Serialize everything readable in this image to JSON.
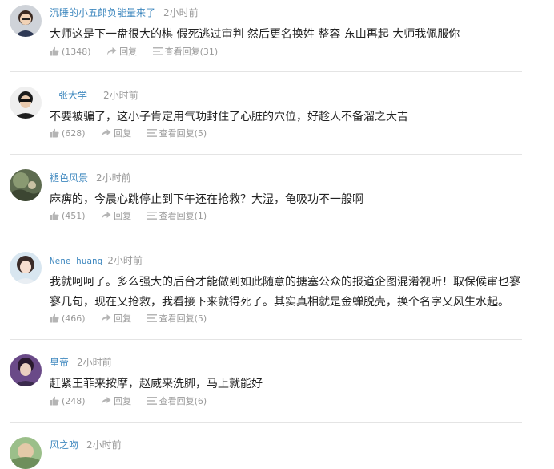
{
  "comments": [
    {
      "user": "沉睡的小五郎负能量来了",
      "time": "2小时前",
      "text": "大师这是下一盘很大的棋  假死逃过审判  然后更名换姓  整容  东山再起  大师我佩服你",
      "likes": "(1348)",
      "reply_label": "回复",
      "view_replies_label": "查看回复(31)"
    },
    {
      "user": "张大学",
      "time": "2小时前",
      "text": "不要被骗了，这小子肯定用气功封住了心脏的穴位，好趁人不备溜之大吉",
      "likes": "(628)",
      "reply_label": "回复",
      "view_replies_label": "查看回复(5)"
    },
    {
      "user": "褪色风景",
      "time": "2小时前",
      "text": "麻痹的，今晨心跳停止到下午还在抢救？大湿，龟吸功不一般啊",
      "likes": "(451)",
      "reply_label": "回复",
      "view_replies_label": "查看回复(1)"
    },
    {
      "user": "Nene huang",
      "time": "2小时前",
      "text": "我就呵呵了。多么强大的后台才能做到如此随意的搪塞公众的报道企图混淆视听！取保候审也寥寥几句，现在又抢救，我看接下来就得死了。其实真相就是金蝉脱壳，换个名字又风生水起。",
      "likes": "(466)",
      "reply_label": "回复",
      "view_replies_label": "查看回复(5)"
    },
    {
      "user": "皇帝",
      "time": "2小时前",
      "text": "赶紧王菲来按摩，赵威来洗脚，马上就能好",
      "likes": "(248)",
      "reply_label": "回复",
      "view_replies_label": "查看回复(6)"
    },
    {
      "user": "风之吻",
      "time": "2小时前"
    }
  ],
  "colors": {
    "username": "#3f88bf",
    "meta": "#999999",
    "text": "#222222",
    "divider": "#e4e4e4"
  },
  "icons": {
    "like": "thumbs-up-icon",
    "reply": "reply-arrow-icon",
    "view_replies": "list-lines-icon"
  }
}
